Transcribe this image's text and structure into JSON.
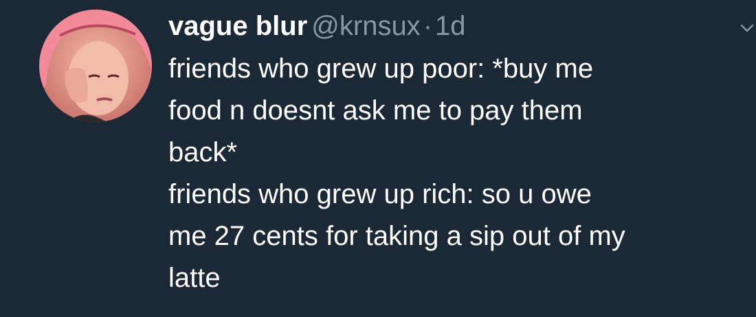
{
  "tweet": {
    "author": {
      "display_name": "vague blur",
      "handle": "@krnsux",
      "separator": "·",
      "timestamp": "1d"
    },
    "lines": [
      "friends who grew up poor: *buy me",
      "food n doesnt ask me to pay them",
      "back*",
      "friends who grew up rich: so u owe",
      "me 27 cents for taking a sip out of my",
      "latte"
    ]
  },
  "icons": {
    "avatar": "avatar-photo",
    "more": "chevron-down-icon"
  },
  "colors": {
    "background": "#1b2836",
    "text_primary": "#ffffff",
    "text_secondary": "#8899a6"
  }
}
